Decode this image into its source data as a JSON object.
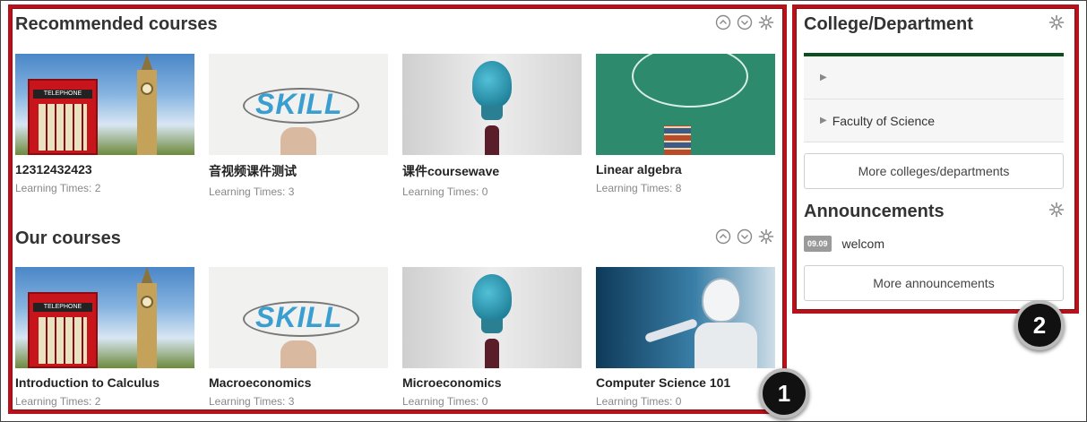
{
  "recommended": {
    "title": "Recommended courses",
    "courses": [
      {
        "name": "12312432423",
        "meta": "Learning Times: 2",
        "image": "london-phone-booth"
      },
      {
        "name": "音视频课件测试",
        "meta": "Learning Times: 3",
        "image": "skill-sketch"
      },
      {
        "name": "课件coursewave",
        "meta": "Learning Times: 0",
        "image": "lightbulb"
      },
      {
        "name": "Linear algebra",
        "meta": "Learning Times: 8",
        "image": "green-chalkboard"
      }
    ]
  },
  "ours": {
    "title": "Our courses",
    "courses": [
      {
        "name": "Introduction to Calculus",
        "meta": "Learning Times: 2",
        "image": "london-phone-booth"
      },
      {
        "name": "Macroeconomics",
        "meta": "Learning Times: 3",
        "image": "skill-sketch"
      },
      {
        "name": "Microeconomics",
        "meta": "Learning Times: 0",
        "image": "lightbulb"
      },
      {
        "name": "Computer Science 101",
        "meta": "Learning Times: 0",
        "image": "robot"
      }
    ]
  },
  "sidebar": {
    "dept_title": "College/Department",
    "departments": [
      {
        "label": ""
      },
      {
        "label": "Faculty of Science"
      }
    ],
    "more_depts": "More colleges/departments",
    "announce_title": "Announcements",
    "announcements": [
      {
        "date": "09.09",
        "text": "welcom"
      }
    ],
    "more_announce": "More announcements"
  },
  "thumb_texts": {
    "telephone": "TELEPHONE",
    "skill": "SKILL"
  },
  "callouts": [
    "1",
    "2"
  ],
  "colors": {
    "callout": "#b5121b",
    "dept_accent": "#0d4f1c"
  },
  "icons": {
    "collapse": "chevron-up-circle-icon",
    "expand": "chevron-down-circle-icon",
    "settings": "gear-icon",
    "tree-arrow": "triangle-right-icon"
  }
}
